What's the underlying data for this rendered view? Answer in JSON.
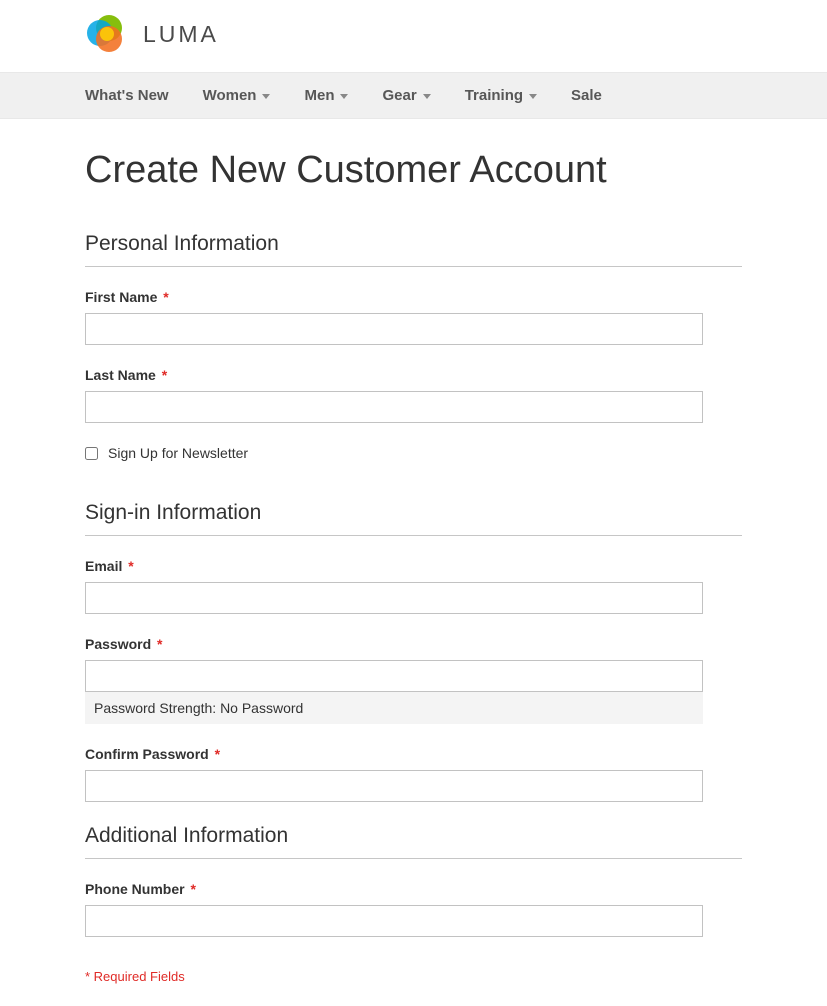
{
  "header": {
    "logo_text": "LUMA"
  },
  "nav": {
    "items": [
      {
        "label": "What's New",
        "has_dropdown": false
      },
      {
        "label": "Women",
        "has_dropdown": true
      },
      {
        "label": "Men",
        "has_dropdown": true
      },
      {
        "label": "Gear",
        "has_dropdown": true
      },
      {
        "label": "Training",
        "has_dropdown": true
      },
      {
        "label": "Sale",
        "has_dropdown": false
      }
    ]
  },
  "page": {
    "title": "Create New Customer Account"
  },
  "fieldsets": {
    "personal": {
      "legend": "Personal Information",
      "first_name_label": "First Name",
      "last_name_label": "Last Name",
      "newsletter_label": "Sign Up for Newsletter"
    },
    "signin": {
      "legend": "Sign-in Information",
      "email_label": "Email",
      "password_label": "Password",
      "confirm_password_label": "Confirm Password",
      "password_strength_prefix": "Password Strength: ",
      "password_strength_value": "No Password"
    },
    "additional": {
      "legend": "Additional Information",
      "phone_label": "Phone Number"
    }
  },
  "footer": {
    "required_note": "* Required Fields"
  }
}
